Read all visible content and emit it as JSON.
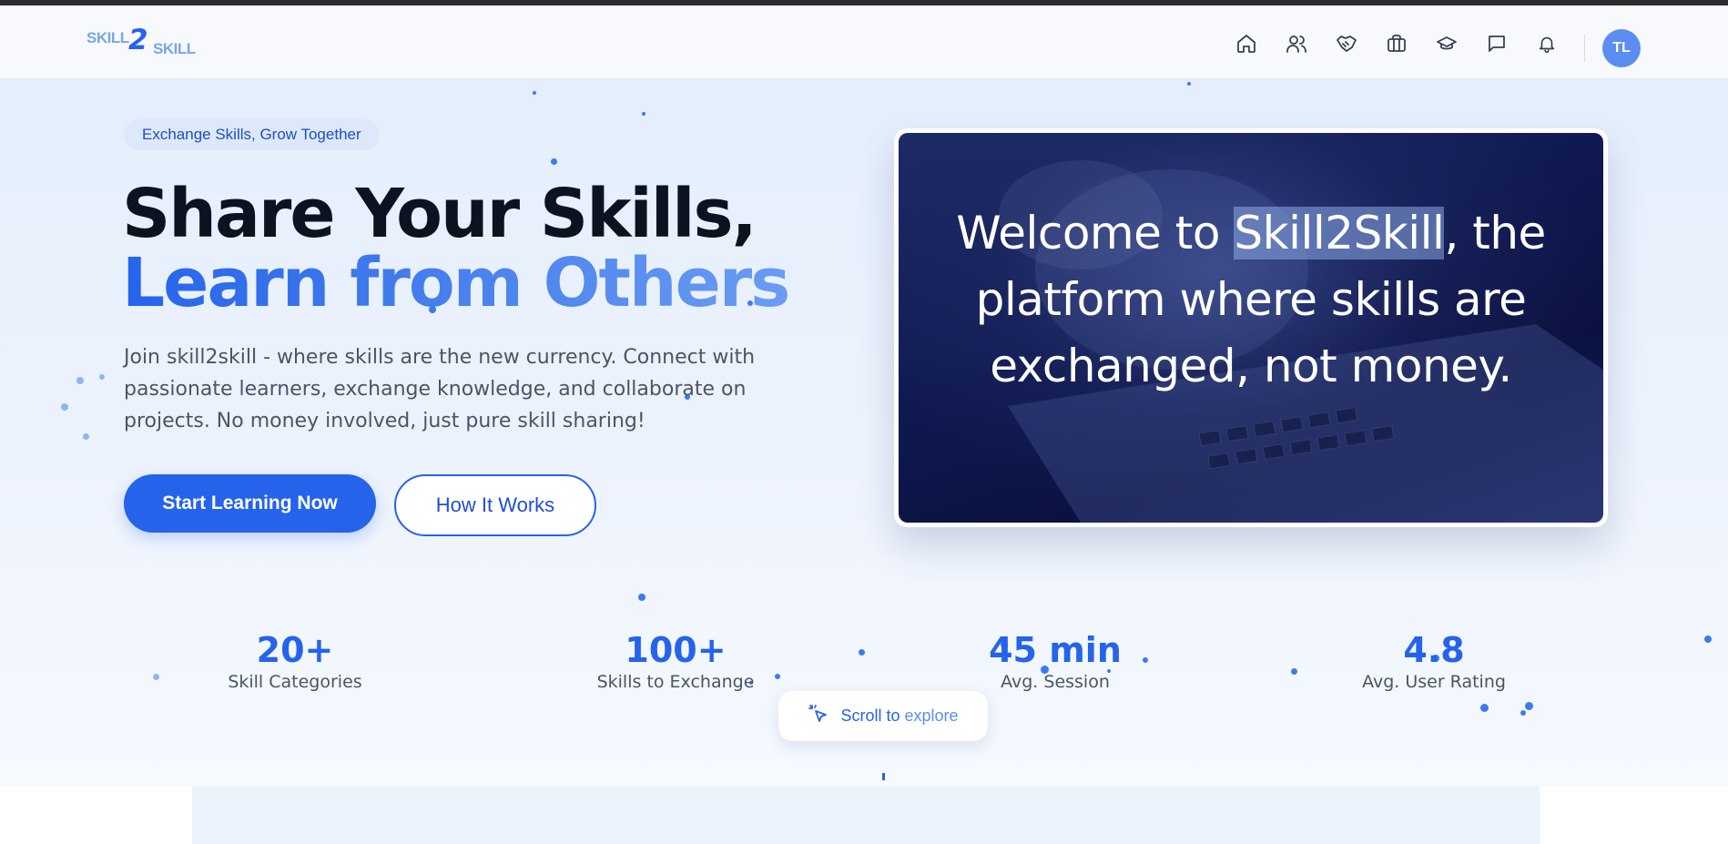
{
  "brand": {
    "logo_part1": "SKILL",
    "logo_part2": "2",
    "logo_part3": "SKILL"
  },
  "nav": {
    "icons": [
      "home-icon",
      "users-icon",
      "handshake-icon",
      "briefcase-icon",
      "graduation-cap-icon",
      "message-icon",
      "bell-icon"
    ],
    "avatar_initials": "TL"
  },
  "hero": {
    "pill": "Exchange Skills, Grow Together",
    "title_line1": "Share Your Skills,",
    "title_line2": "Learn from Others",
    "description": "Join skill2skill - where skills are the new currency. Connect with passionate learners, exchange knowledge, and collaborate on projects. No money involved, just pure skill sharing!",
    "primary_button": "Start Learning Now",
    "secondary_button": "How It Works"
  },
  "video": {
    "text_before": "Welcome to ",
    "text_highlight": "Skill2Skill",
    "text_after": ", the platform where skills are exchanged, not money."
  },
  "stats": [
    {
      "value": "20+",
      "label": "Skill Categories"
    },
    {
      "value": "100+",
      "label": "Skills to Exchange"
    },
    {
      "value": "45 min",
      "label": "Avg. Session"
    },
    {
      "value": "4.8",
      "label": "Avg. User Rating"
    }
  ],
  "scroll_hint": {
    "label_part1": "Scroll to ",
    "label_part2": "explore"
  },
  "colors": {
    "accent": "#2563eb",
    "avatar_bg": "#5b8ef0",
    "hero_bg": "#e4eefc",
    "video_bg": "#101a52"
  }
}
